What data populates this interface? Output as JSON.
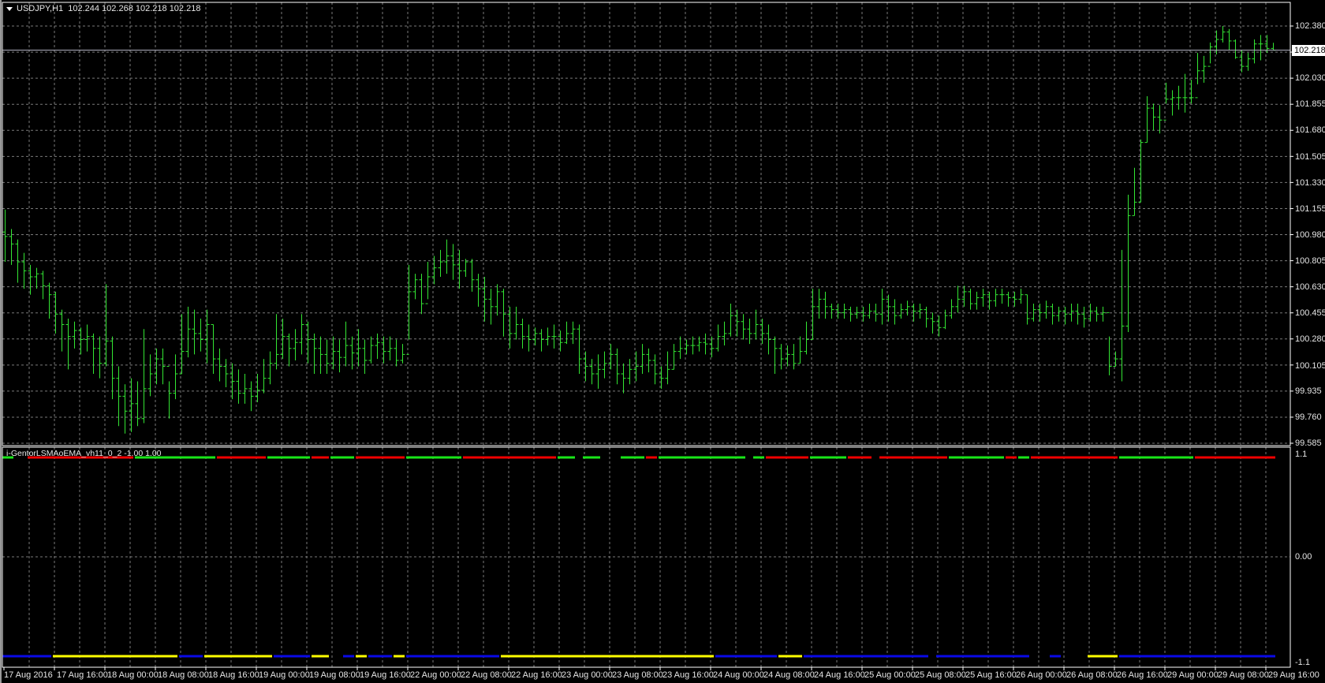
{
  "window": {
    "symbol_header": "USDJPY,H1",
    "ohlc_header": "102.244 102.268 102.218 102.218",
    "indicator_label": "i-GentorLSMAoEMA_vh11_0_2 -1.00 1.00"
  },
  "colors": {
    "background": "#000000",
    "bar": "#33e633",
    "grid": "#7a7a7a",
    "axis": "#ffffff",
    "current_price_line": "#b8b8c8",
    "green": "#19e619",
    "red": "#f00000",
    "blue": "#0a0ae6",
    "yellow": "#ffff00"
  },
  "chart_data": [
    {
      "type": "ohlc",
      "title": "USDJPY,H1",
      "ylim": [
        99.585,
        102.38
      ],
      "current_price": "102.218",
      "price_ticks": [
        "102.380",
        "102.030",
        "101.855",
        "101.680",
        "101.505",
        "101.330",
        "101.155",
        "100.980",
        "100.805",
        "100.630",
        "100.455",
        "100.280",
        "100.105",
        "99.935",
        "99.760",
        "99.585"
      ],
      "time_labels": [
        "17 Aug 2016",
        "17 Aug 16:00",
        "18 Aug 00:00",
        "18 Aug 08:00",
        "18 Aug 16:00",
        "19 Aug 00:00",
        "19 Aug 08:00",
        "19 Aug 16:00",
        "22 Aug 00:00",
        "22 Aug 08:00",
        "22 Aug 16:00",
        "23 Aug 00:00",
        "23 Aug 08:00",
        "23 Aug 16:00",
        "24 Aug 00:00",
        "24 Aug 08:00",
        "24 Aug 16:00",
        "25 Aug 00:00",
        "25 Aug 08:00",
        "25 Aug 16:00",
        "26 Aug 00:00",
        "26 Aug 08:00",
        "26 Aug 16:00",
        "29 Aug 00:00",
        "29 Aug 08:00",
        "29 Aug 16:00"
      ],
      "bars_per_label": 8,
      "first_open": 101.0,
      "close": [
        100.97,
        100.92,
        100.8,
        100.74,
        100.7,
        100.72,
        100.64,
        100.58,
        100.45,
        100.38,
        100.3,
        100.34,
        100.28,
        100.3,
        100.22,
        100.12,
        100.27,
        100.02,
        99.9,
        99.8,
        99.85,
        99.75,
        99.95,
        100.05,
        100.15,
        100.1,
        99.92,
        100.05,
        100.2,
        100.35,
        100.32,
        100.28,
        100.38,
        100.15,
        100.1,
        100.05,
        100.0,
        99.92,
        99.95,
        99.9,
        99.94,
        100.02,
        100.12,
        100.18,
        100.3,
        100.22,
        100.26,
        100.38,
        100.28,
        100.22,
        100.18,
        100.12,
        100.2,
        100.16,
        100.24,
        100.19,
        100.22,
        100.14,
        100.24,
        100.26,
        100.2,
        100.22,
        100.14,
        100.18,
        100.6,
        100.68,
        100.52,
        100.7,
        100.76,
        100.8,
        100.84,
        100.78,
        100.74,
        100.8,
        100.68,
        100.62,
        100.55,
        100.5,
        100.6,
        100.45,
        100.32,
        100.38,
        100.3,
        100.28,
        100.32,
        100.28,
        100.3,
        100.3,
        100.26,
        100.32,
        100.35,
        100.15,
        100.1,
        100.05,
        100.08,
        100.12,
        100.18,
        100.05,
        100.02,
        100.08,
        100.1,
        100.18,
        100.14,
        100.05,
        100.02,
        100.08,
        100.2,
        100.22,
        100.24,
        100.24,
        100.26,
        100.25,
        100.22,
        100.3,
        100.32,
        100.44,
        100.4,
        100.35,
        100.32,
        100.38,
        100.32,
        100.28,
        100.22,
        100.15,
        100.18,
        100.12,
        100.2,
        100.28,
        100.5,
        100.55,
        100.5,
        100.48,
        100.46,
        100.48,
        100.45,
        100.46,
        100.44,
        100.47,
        100.45,
        100.55,
        100.5,
        100.44,
        100.48,
        100.5,
        100.47,
        100.48,
        100.42,
        100.4,
        100.36,
        100.44,
        100.5,
        100.55,
        100.6,
        100.52,
        100.56,
        100.58,
        100.54,
        100.58,
        100.58,
        100.56,
        100.55,
        100.58,
        100.42,
        100.48,
        100.46,
        100.5,
        100.44,
        100.47,
        100.45,
        100.47,
        100.45,
        100.42,
        100.47,
        100.45,
        100.46,
        100.1,
        100.15,
        100.37,
        101.11,
        101.2,
        101.6,
        101.83,
        101.77,
        101.75,
        101.89,
        101.9,
        101.9,
        101.9,
        101.9,
        102.08,
        102.11,
        102.24,
        102.29,
        102.34,
        102.28,
        102.17,
        102.11,
        102.16,
        102.26,
        102.26,
        102.23,
        102.218
      ],
      "high": [
        101.15,
        101.02,
        100.95,
        100.86,
        100.78,
        100.76,
        100.74,
        100.66,
        100.6,
        100.48,
        100.42,
        100.4,
        100.36,
        100.38,
        100.32,
        100.3,
        100.65,
        100.3,
        100.1,
        99.98,
        100.02,
        100.0,
        100.35,
        100.18,
        100.22,
        100.22,
        100.0,
        100.18,
        100.45,
        100.5,
        100.48,
        100.42,
        100.48,
        100.38,
        100.22,
        100.15,
        100.12,
        100.08,
        100.05,
        100.0,
        100.05,
        100.15,
        100.2,
        100.45,
        100.42,
        100.32,
        100.35,
        100.45,
        100.4,
        100.32,
        100.3,
        100.28,
        100.3,
        100.28,
        100.4,
        100.3,
        100.35,
        100.28,
        100.3,
        100.32,
        100.3,
        100.3,
        100.28,
        100.25,
        100.78,
        100.72,
        100.72,
        100.8,
        100.84,
        100.88,
        100.95,
        100.92,
        100.88,
        100.82,
        100.82,
        100.72,
        100.7,
        100.62,
        100.65,
        100.62,
        100.5,
        100.5,
        100.42,
        100.38,
        100.36,
        100.35,
        100.36,
        100.38,
        100.34,
        100.4,
        100.4,
        100.38,
        100.2,
        100.15,
        100.18,
        100.2,
        100.25,
        100.22,
        100.12,
        100.15,
        100.2,
        100.25,
        100.22,
        100.18,
        100.1,
        100.2,
        100.25,
        100.3,
        100.28,
        100.3,
        100.3,
        100.32,
        100.3,
        100.38,
        100.4,
        100.52,
        100.48,
        100.45,
        100.42,
        100.48,
        100.42,
        100.38,
        100.3,
        100.25,
        100.24,
        100.25,
        100.3,
        100.4,
        100.62,
        100.62,
        100.6,
        100.52,
        100.52,
        100.52,
        100.5,
        100.5,
        100.5,
        100.52,
        100.52,
        100.62,
        100.58,
        100.55,
        100.52,
        100.54,
        100.52,
        100.52,
        100.5,
        100.46,
        100.44,
        100.48,
        100.55,
        100.64,
        100.64,
        100.62,
        100.6,
        100.62,
        100.6,
        100.62,
        100.62,
        100.6,
        100.6,
        100.62,
        100.58,
        100.52,
        100.52,
        100.54,
        100.52,
        100.5,
        100.5,
        100.52,
        100.52,
        100.5,
        100.52,
        100.5,
        100.5,
        100.3,
        100.2,
        100.88,
        101.25,
        101.43,
        101.62,
        101.91,
        101.86,
        101.85,
        102.0,
        101.95,
        101.98,
        102.06,
        102.02,
        102.2,
        102.18,
        102.27,
        102.35,
        102.38,
        102.36,
        102.29,
        102.22,
        102.2,
        102.29,
        102.32,
        102.32,
        102.268
      ],
      "low": [
        100.8,
        100.78,
        100.66,
        100.62,
        100.58,
        100.62,
        100.55,
        100.42,
        100.32,
        100.2,
        100.08,
        100.22,
        100.18,
        100.2,
        100.05,
        100.02,
        100.1,
        99.88,
        99.7,
        99.65,
        99.66,
        99.7,
        99.72,
        99.9,
        99.98,
        99.98,
        99.75,
        99.88,
        100.05,
        100.16,
        100.18,
        100.2,
        100.12,
        100.05,
        100.0,
        99.96,
        99.88,
        99.85,
        99.85,
        99.8,
        99.86,
        99.92,
        99.98,
        100.08,
        100.15,
        100.1,
        100.14,
        100.18,
        100.12,
        100.05,
        100.05,
        100.05,
        100.08,
        100.06,
        100.1,
        100.08,
        100.1,
        100.05,
        100.12,
        100.15,
        100.12,
        100.14,
        100.1,
        100.12,
        100.28,
        100.55,
        100.45,
        100.55,
        100.65,
        100.7,
        100.72,
        100.68,
        100.62,
        100.7,
        100.6,
        100.5,
        100.4,
        100.38,
        100.44,
        100.3,
        100.22,
        100.28,
        100.22,
        100.2,
        100.24,
        100.2,
        100.24,
        100.22,
        100.2,
        100.25,
        100.25,
        100.05,
        100.0,
        99.98,
        99.95,
        100.02,
        100.08,
        99.98,
        99.92,
        99.98,
        100.0,
        100.05,
        100.06,
        99.98,
        99.95,
        99.98,
        100.08,
        100.15,
        100.18,
        100.18,
        100.2,
        100.18,
        100.16,
        100.2,
        100.24,
        100.3,
        100.3,
        100.28,
        100.25,
        100.28,
        100.25,
        100.18,
        100.05,
        100.08,
        100.1,
        100.08,
        100.12,
        100.18,
        100.28,
        100.42,
        100.42,
        100.42,
        100.42,
        100.42,
        100.4,
        100.42,
        100.4,
        100.42,
        100.4,
        100.38,
        100.4,
        100.38,
        100.42,
        100.44,
        100.4,
        100.42,
        100.36,
        100.32,
        100.3,
        100.35,
        100.42,
        100.46,
        100.5,
        100.48,
        100.48,
        100.5,
        100.48,
        100.5,
        100.52,
        100.5,
        100.5,
        100.52,
        100.38,
        100.4,
        100.4,
        100.42,
        100.38,
        100.4,
        100.38,
        100.4,
        100.38,
        100.36,
        100.4,
        100.4,
        100.4,
        100.04,
        100.1,
        100.0,
        100.33,
        101.11,
        101.2,
        101.6,
        101.68,
        101.66,
        101.86,
        101.78,
        101.82,
        101.8,
        101.86,
        101.99,
        102.0,
        102.13,
        102.19,
        102.27,
        102.22,
        102.16,
        102.07,
        102.08,
        102.13,
        102.15,
        102.2,
        102.218
      ]
    },
    {
      "type": "line",
      "title": "i-GentorLSMAoEMA_vh11_0_2 -1.00 1.00",
      "ylim": [
        -1.1,
        1.1
      ],
      "y_ticks": [
        "1.1",
        "0.00",
        "-1.1"
      ],
      "upper_line": {
        "value": 1.0,
        "segments": [
          {
            "from": 0,
            "to": 1,
            "color": "green"
          },
          {
            "from": 4,
            "to": 20,
            "color": "red"
          },
          {
            "from": 21,
            "to": 33,
            "color": "green"
          },
          {
            "from": 34,
            "to": 41,
            "color": "red"
          },
          {
            "from": 42,
            "to": 48,
            "color": "green"
          },
          {
            "from": 49,
            "to": 51,
            "color": "red"
          },
          {
            "from": 52,
            "to": 55,
            "color": "green"
          },
          {
            "from": 56,
            "to": 63,
            "color": "red"
          },
          {
            "from": 64,
            "to": 72,
            "color": "green"
          },
          {
            "from": 73,
            "to": 87,
            "color": "red"
          },
          {
            "from": 88,
            "to": 90,
            "color": "green"
          },
          {
            "from": 92,
            "to": 94,
            "color": "green"
          },
          {
            "from": 98,
            "to": 101,
            "color": "green"
          },
          {
            "from": 102,
            "to": 103,
            "color": "red"
          },
          {
            "from": 104,
            "to": 117,
            "color": "green"
          },
          {
            "from": 119,
            "to": 120,
            "color": "green"
          },
          {
            "from": 121,
            "to": 127,
            "color": "red"
          },
          {
            "from": 128,
            "to": 133,
            "color": "green"
          },
          {
            "from": 134,
            "to": 137,
            "color": "red"
          },
          {
            "from": 139,
            "to": 149,
            "color": "red"
          },
          {
            "from": 150,
            "to": 158,
            "color": "green"
          },
          {
            "from": 159,
            "to": 160,
            "color": "red"
          },
          {
            "from": 161,
            "to": 162,
            "color": "green"
          },
          {
            "from": 163,
            "to": 176,
            "color": "red"
          },
          {
            "from": 177,
            "to": 188,
            "color": "green"
          },
          {
            "from": 189,
            "to": 201,
            "color": "red"
          }
        ]
      },
      "lower_line": {
        "value": -1.0,
        "segments": [
          {
            "from": 0,
            "to": 7,
            "color": "blue"
          },
          {
            "from": 8,
            "to": 27,
            "color": "yellow"
          },
          {
            "from": 28,
            "to": 31,
            "color": "blue"
          },
          {
            "from": 32,
            "to": 42,
            "color": "yellow"
          },
          {
            "from": 43,
            "to": 48,
            "color": "blue"
          },
          {
            "from": 49,
            "to": 51,
            "color": "yellow"
          },
          {
            "from": 54,
            "to": 55,
            "color": "blue"
          },
          {
            "from": 56,
            "to": 57,
            "color": "yellow"
          },
          {
            "from": 58,
            "to": 61,
            "color": "blue"
          },
          {
            "from": 62,
            "to": 63,
            "color": "yellow"
          },
          {
            "from": 64,
            "to": 78,
            "color": "blue"
          },
          {
            "from": 79,
            "to": 112,
            "color": "yellow"
          },
          {
            "from": 113,
            "to": 122,
            "color": "blue"
          },
          {
            "from": 123,
            "to": 126,
            "color": "yellow"
          },
          {
            "from": 127,
            "to": 146,
            "color": "blue"
          },
          {
            "from": 148,
            "to": 162,
            "color": "blue"
          },
          {
            "from": 166,
            "to": 167,
            "color": "blue"
          },
          {
            "from": 172,
            "to": 176,
            "color": "yellow"
          },
          {
            "from": 177,
            "to": 201,
            "color": "blue"
          }
        ]
      }
    }
  ]
}
